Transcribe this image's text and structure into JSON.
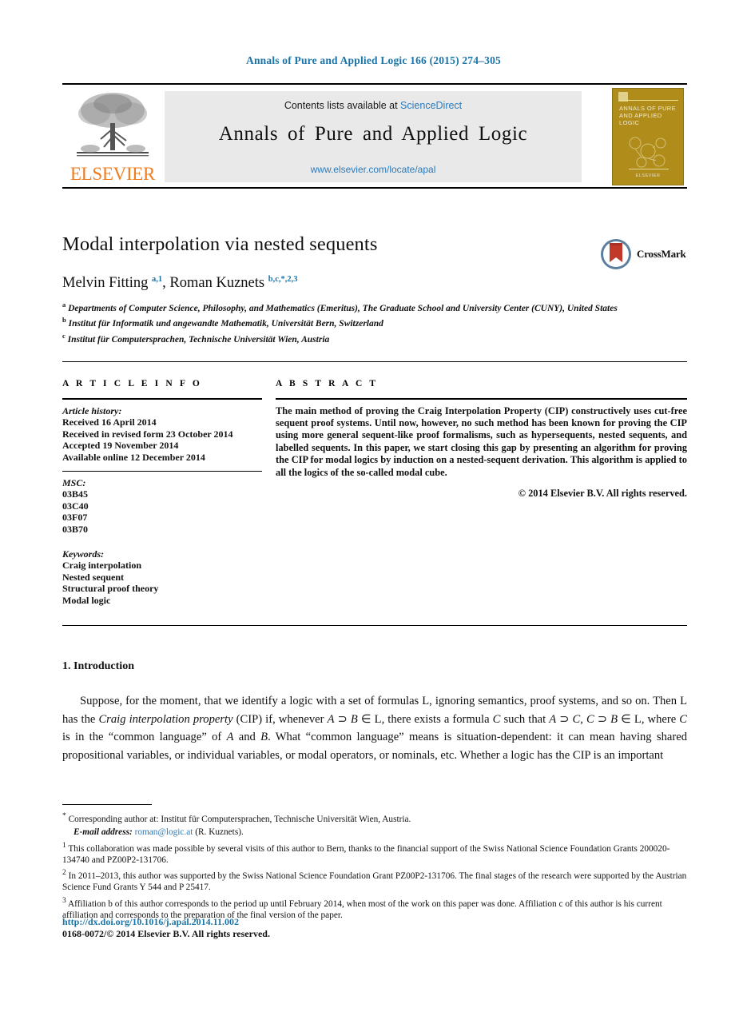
{
  "running_head": "Annals of Pure and Applied Logic 166 (2015) 274–305",
  "masthead": {
    "contents_prefix": "Contents lists available at ",
    "sciencedirect": "ScienceDirect",
    "journal_title": "Annals of Pure and Applied Logic",
    "journal_url": "www.elsevier.com/locate/apal",
    "publisher_wordmark": "ELSEVIER",
    "cover": {
      "title": "ANNALS OF PURE AND APPLIED LOGIC",
      "footer": "ELSEVIER"
    }
  },
  "article": {
    "title": "Modal interpolation via nested sequents",
    "crossmark_label": "CrossMark",
    "authors_html": "Melvin Fitting <sup>a,1</sup>, Roman Kuznets <sup>b,c,*,2,3</sup>",
    "affiliations": [
      {
        "marker": "a",
        "text": "Departments of Computer Science, Philosophy, and Mathematics (Emeritus), The Graduate School and University Center (CUNY), United States"
      },
      {
        "marker": "b",
        "text": "Institut für Informatik und angewandte Mathematik, Universität Bern, Switzerland"
      },
      {
        "marker": "c",
        "text": "Institut für Computersprachen, Technische Universität Wien, Austria"
      }
    ]
  },
  "info": {
    "heading": "A R T I C L E   I N F O",
    "history_label": "Article history:",
    "history": [
      "Received 16 April 2014",
      "Received in revised form 23 October 2014",
      "Accepted 19 November 2014",
      "Available online 12 December 2014"
    ],
    "msc_label": "MSC:",
    "msc": [
      "03B45",
      "03C40",
      "03F07",
      "03B70"
    ],
    "keywords_label": "Keywords:",
    "keywords": [
      "Craig interpolation",
      "Nested sequent",
      "Structural proof theory",
      "Modal logic"
    ]
  },
  "abstract": {
    "heading": "A B S T R A C T",
    "text": "The main method of proving the Craig Interpolation Property (CIP) constructively uses cut-free sequent proof systems. Until now, however, no such method has been known for proving the CIP using more general sequent-like proof formalisms, such as hypersequents, nested sequents, and labelled sequents. In this paper, we start closing this gap by presenting an algorithm for proving the CIP for modal logics by induction on a nested-sequent derivation. This algorithm is applied to all the logics of the so-called modal cube.",
    "copyright": "© 2014 Elsevier B.V. All rights reserved."
  },
  "body": {
    "section_title": "1. Introduction",
    "paragraph_html": "Suppose, for the moment, that we identify a logic with a set of formulas L, ignoring semantics, proof systems, and so on. Then L has the <i>Craig interpolation property</i> (CIP) if, whenever <i>A</i> ⊃ <i>B</i> ∈ L, there exists a formula <i>C</i> such that <i>A</i> ⊃ <i>C</i>, <i>C</i> ⊃ <i>B</i> ∈ L, where <i>C</i> is in the “common language” of <i>A</i> and <i>B</i>. What “common language” means is situation-dependent: it can mean having shared propositional variables, or individual variables, or modal operators, or nominals, etc. Whether a logic has the CIP is an important"
  },
  "footnotes": [
    {
      "marker": "*",
      "html": "Corresponding author at: Institut für Computersprachen, Technische Universität Wien, Austria."
    },
    {
      "marker": "",
      "html": "<span class=\"em\">E-mail address:</span> <a href=\"#\">roman@logic.at</a> (R. Kuznets)."
    },
    {
      "marker": "1",
      "html": "This collaboration was made possible by several visits of this author to Bern, thanks to the financial support of the Swiss National Science Foundation Grants 200020-134740 and PZ00P2-131706."
    },
    {
      "marker": "2",
      "html": "In 2011–2013, this author was supported by the Swiss National Science Foundation Grant PZ00P2-131706. The final stages of the research were supported by the Austrian Science Fund Grants Y 544 and P 25417."
    },
    {
      "marker": "3",
      "html": "Affiliation b of this author corresponds to the period up until February 2014, when most of the work on this paper was done. Affiliation c of this author is his current affiliation and corresponds to the preparation of the final version of the paper."
    }
  ],
  "footer": {
    "doi": "http://dx.doi.org/10.1016/j.apal.2014.11.002",
    "issn_line": "0168-0072/© 2014 Elsevier B.V. All rights reserved."
  },
  "colors": {
    "link_blue": "#2b7bbd",
    "header_blue": "#1a74a8",
    "elsevier_orange": "#f07c1e",
    "cover_gold": "#b08d1b",
    "masthead_gray": "#e9e9e9"
  }
}
